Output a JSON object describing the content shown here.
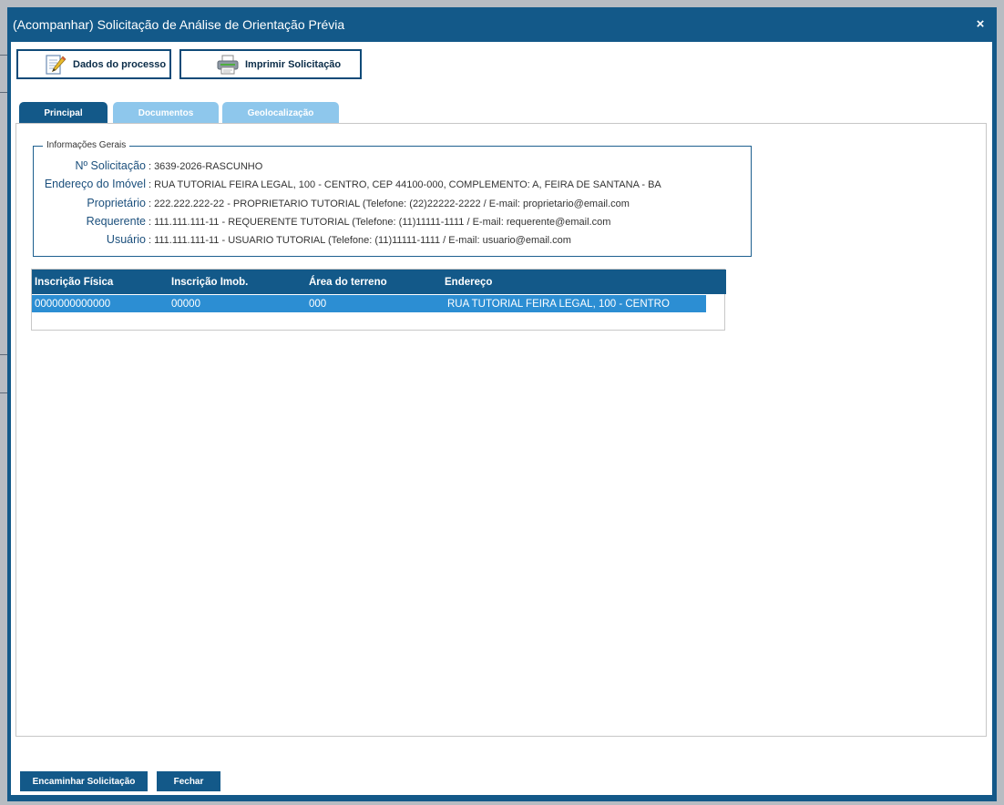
{
  "dialog": {
    "title": "(Acompanhar) Solicitação de Análise de Orientação Prévia",
    "close_label": "×"
  },
  "toolbar": {
    "dados_label": "Dados do processo",
    "imprimir_label": "Imprimir Solicitação"
  },
  "tabs": [
    {
      "label": "Principal",
      "active": true
    },
    {
      "label": "Documentos",
      "active": false
    },
    {
      "label": "Geolocalização",
      "active": false
    }
  ],
  "info": {
    "legend": "Informações Gerais",
    "rows": [
      {
        "label": "Nº Solicitação",
        "value": "3639-2026-RASCUNHO"
      },
      {
        "label": "Endereço do Imóvel",
        "value": "RUA TUTORIAL FEIRA LEGAL, 100 - CENTRO, CEP 44100-000, COMPLEMENTO: A, FEIRA DE SANTANA - BA"
      },
      {
        "label": "Proprietário",
        "value": "222.222.222-22 - PROPRIETARIO TUTORIAL (Telefone: (22)22222-2222 / E-mail: proprietario@email.com"
      },
      {
        "label": "Requerente",
        "value": "111.111.111-11 - REQUERENTE TUTORIAL (Telefone: (11)11111-1111 / E-mail: requerente@email.com"
      },
      {
        "label": "Usuário",
        "value": "111.111.111-11 - USUARIO TUTORIAL (Telefone: (11)11111-1111 / E-mail: usuario@email.com"
      }
    ]
  },
  "grid": {
    "columns": [
      "Inscrição Física",
      "Inscrição Imob.",
      "Área do terreno",
      "Endereço"
    ],
    "rows": [
      [
        "0000000000000",
        "00000",
        "000",
        "RUA TUTORIAL FEIRA LEGAL, 100 - CENTRO"
      ]
    ]
  },
  "footer": {
    "forward_label": "Encaminhar Solicitação",
    "close_label": "Fechar"
  },
  "colors": {
    "primary": "#135989",
    "tab_inactive": "#8ec7ec",
    "row_selected": "#2c8ed3"
  }
}
